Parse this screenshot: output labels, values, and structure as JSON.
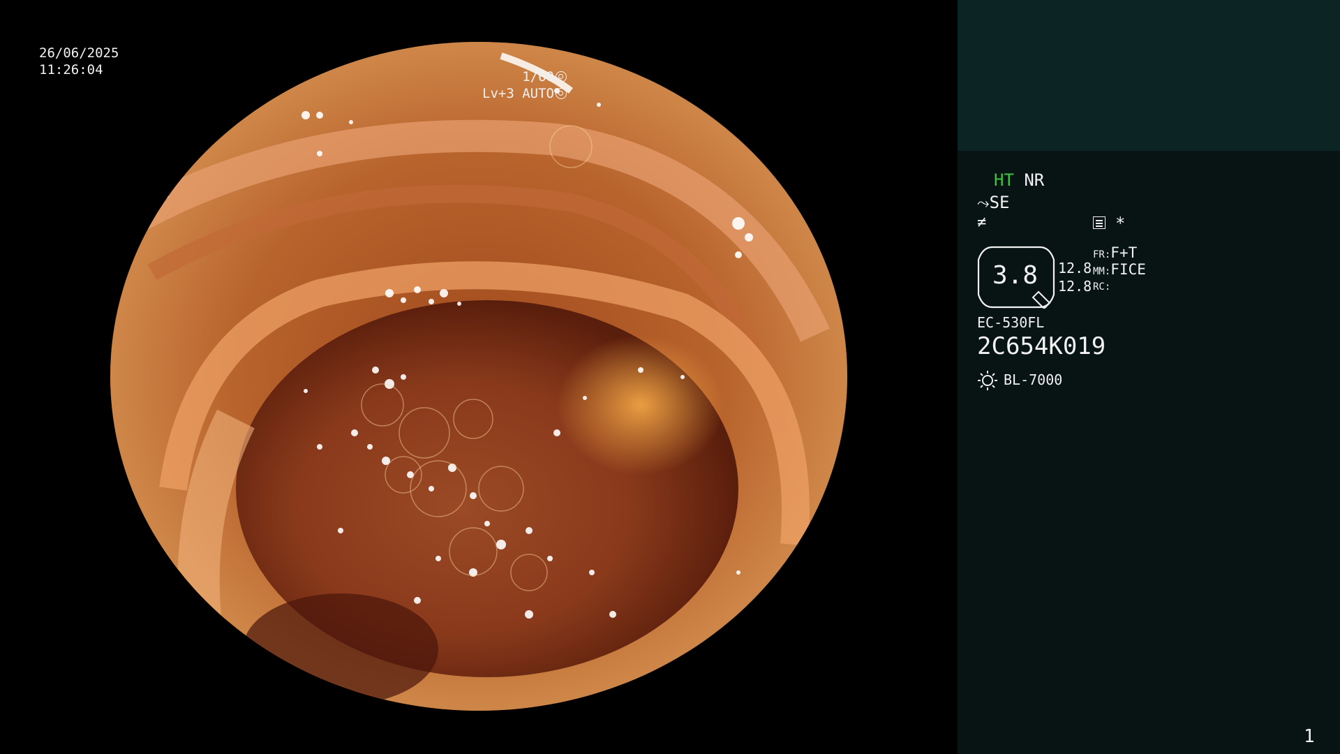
{
  "overlay": {
    "date": "26/06/2025",
    "time": "11:26:04",
    "shutter": "1/60",
    "level": "Lv+3 AUTO",
    "shutter_icon": "aperture-icon",
    "auto_icon": "iris-icon"
  },
  "panel": {
    "mode_ht": "HT",
    "mode_nr": "NR",
    "se_label": "SE",
    "se_icon": "pen-icon",
    "slash_icon": "not-equal-icon",
    "menu_icon": "menu-list-icon",
    "star": "*",
    "zoom_value": "3.8",
    "val1": "12.8",
    "val2": "12.8",
    "fr_label": "FR:",
    "fr_value": "F+T",
    "mm_label": "MM:",
    "mm_value": "FICE",
    "rc_label": "RC:",
    "scope_model": "EC-530FL",
    "serial": "2C654K019",
    "light_icon": "sun-icon",
    "light_source": "BL-7000",
    "page": "1"
  },
  "colors": {
    "panel_bg": "#081313",
    "panel_top_bg": "#0c2424",
    "ht_green": "#3ec53e",
    "text": "#f2f2f2"
  }
}
